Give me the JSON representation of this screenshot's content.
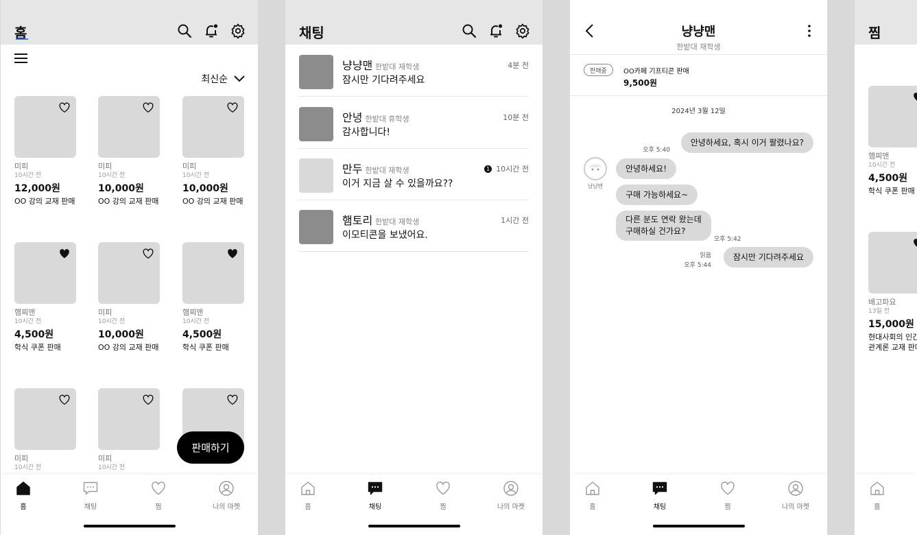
{
  "colors": {
    "accent": "#3b7ddd",
    "placeholder": "#d9d9d9",
    "avatar_dark": "#8c8c8c",
    "bubble": "#d9d9d9",
    "appbar": "#e6e6e6"
  },
  "home": {
    "title": "홈",
    "sort_label": "최신순",
    "sell_button": "판매하기",
    "products": [
      {
        "seller": "미피",
        "time": "10시간 전",
        "price": "12,000원",
        "name": "OO 강의 교재 판매",
        "liked": false
      },
      {
        "seller": "미피",
        "time": "10시간 전",
        "price": "10,000원",
        "name": "OO 강의 교재 판매",
        "liked": false
      },
      {
        "seller": "미피",
        "time": "10시간 전",
        "price": "10,000원",
        "name": "OO 강의 교재 판매",
        "liked": false
      },
      {
        "seller": "햄찌맨",
        "time": "10시간 전",
        "price": "4,500원",
        "name": "학식 쿠폰 판매",
        "liked": true
      },
      {
        "seller": "미피",
        "time": "10시간 전",
        "price": "10,000원",
        "name": "OO 강의 교재 판매",
        "liked": false
      },
      {
        "seller": "햄찌맨",
        "time": "10시간 전",
        "price": "4,500원",
        "name": "학식 쿠폰 판매",
        "liked": true
      },
      {
        "seller": "미피",
        "time": "10시간 전",
        "price": "",
        "name": "",
        "liked": false
      },
      {
        "seller": "미피",
        "time": "10시간 전",
        "price": "",
        "name": "",
        "liked": false
      },
      {
        "seller": "",
        "time": "10시간 전",
        "price": "",
        "name": "",
        "liked": false
      }
    ]
  },
  "nav": {
    "home": "홈",
    "chat": "채팅",
    "wish": "찜",
    "my": "나의 마켓"
  },
  "chat_list": {
    "title": "채팅",
    "rooms": [
      {
        "name": "냥냥맨",
        "school": "한밭대 재학생",
        "message": "잠시만 기다려주세요",
        "time": "4분 전",
        "unread": ""
      },
      {
        "name": "안녕",
        "school": "한밭대 휴학생",
        "message": "감사합니다!",
        "time": "10분 전",
        "unread": ""
      },
      {
        "name": "만두",
        "school": "한밭대 재학생",
        "message": "이거 지금 살 수 있을까요??",
        "time": "10시간 전",
        "unread": "1"
      },
      {
        "name": "햄토리",
        "school": "한밭대 재학생",
        "message": "이모티콘을 보냈어요.",
        "time": "1시간 전",
        "unread": ""
      }
    ]
  },
  "chat_room": {
    "title": "냥냥맨",
    "subtitle": "한밭대 재학생",
    "product": {
      "status": "판매중",
      "title": "OO카페 기프티콘 판매",
      "price": "9,500원"
    },
    "date": "2024년 3월 12일",
    "peer_name": "냥냥맨",
    "messages": {
      "m1": {
        "text": "안녕하세요, 혹시 이거 팔렸나요?",
        "time": "오후 5:40"
      },
      "m2": {
        "text": "안녕하세요!"
      },
      "m3": {
        "text": "구매 가능하세요~"
      },
      "m4": {
        "line1": "다른 분도 연락 왔는데",
        "line2": "구매하실 건가요?",
        "time": "오후 5:42"
      },
      "m5": {
        "text": "잠시만 기다려주세요",
        "read": "읽음",
        "time": "오후 5:44"
      }
    }
  },
  "wishlist": {
    "title": "찜",
    "items": [
      {
        "seller": "햄찌맨",
        "time": "10시간 전",
        "price": "4,500원",
        "name": "학식 쿠폰 판매"
      },
      {
        "seller": "배고파요",
        "time": "13일 전",
        "price": "15,000원",
        "line1": "현대사회의 인간",
        "line2": "관계론 교재 판매"
      }
    ]
  }
}
